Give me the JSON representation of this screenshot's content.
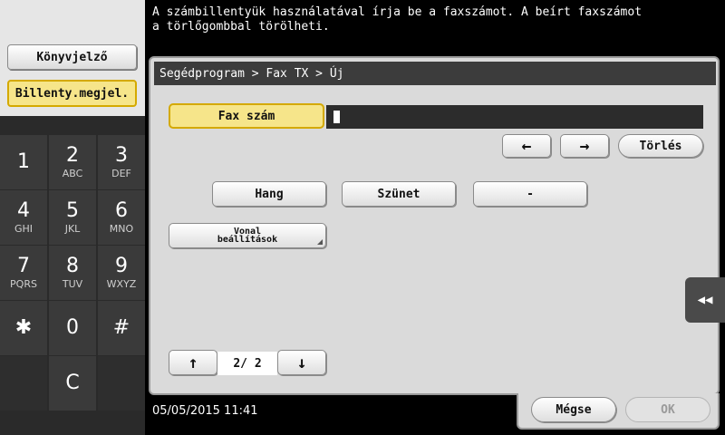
{
  "message": "A számbillentyük használatával írja be a faxszámot. A beírt faxszámot\na törlőgombbal törölheti.",
  "left_panel": {
    "bookmark_label": "Könyvjelző",
    "keypad_label": "Billenty.megjel."
  },
  "keypad": [
    {
      "digit": "1",
      "letters": ""
    },
    {
      "digit": "2",
      "letters": "ABC"
    },
    {
      "digit": "3",
      "letters": "DEF"
    },
    {
      "digit": "4",
      "letters": "GHI"
    },
    {
      "digit": "5",
      "letters": "JKL"
    },
    {
      "digit": "6",
      "letters": "MNO"
    },
    {
      "digit": "7",
      "letters": "PQRS"
    },
    {
      "digit": "8",
      "letters": "TUV"
    },
    {
      "digit": "9",
      "letters": "WXYZ"
    },
    {
      "digit": "✱",
      "letters": ""
    },
    {
      "digit": "0",
      "letters": ""
    },
    {
      "digit": "#",
      "letters": ""
    },
    {
      "digit": "C",
      "letters": ""
    }
  ],
  "main": {
    "breadcrumb": "Segédprogram > Fax TX > Új",
    "fax_label": "Fax szám",
    "fax_value": "",
    "left_arrow": "←",
    "right_arrow": "→",
    "delete_label": "Törlés",
    "hang_label": "Hang",
    "szunet_label": "Szünet",
    "dash_label": "-",
    "line_line1": "Vonal",
    "line_line2": "beállítások",
    "up_arrow": "↑",
    "down_arrow": "↓",
    "page_indicator": "2/ 2"
  },
  "collapse_icon": "◀◀",
  "footer": {
    "datetime": "05/05/2015  11:41",
    "cancel_label": "Mégse",
    "ok_label": "OK"
  }
}
